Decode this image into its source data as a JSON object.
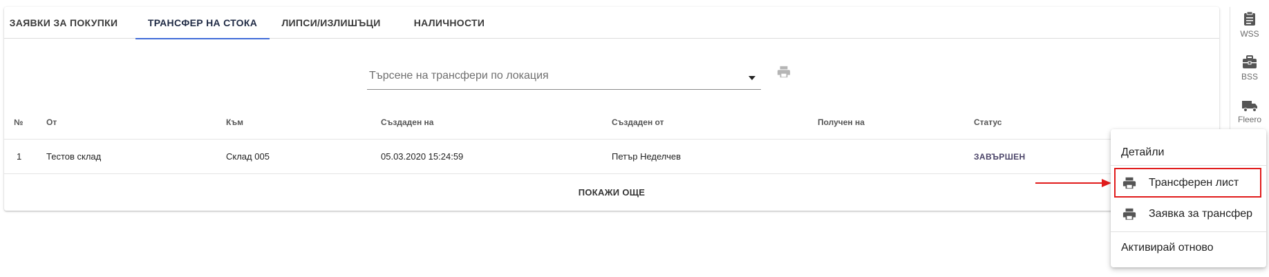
{
  "tabs": [
    {
      "label": "ЗАЯВКИ ЗА ПОКУПКИ",
      "active": false
    },
    {
      "label": "ТРАНСФЕР НА СТОКА",
      "active": true
    },
    {
      "label": "ЛИПСИ/ИЗЛИШЪЦИ",
      "active": false
    },
    {
      "label": "НАЛИЧНОСТИ",
      "active": false
    }
  ],
  "search": {
    "placeholder": "Търсене на трансфери по локация",
    "value": ""
  },
  "table": {
    "columns": [
      "№",
      "От",
      "Към",
      "Създаден на",
      "Създаден от",
      "Получен на",
      "Статус"
    ],
    "rows": [
      {
        "no": "1",
        "from": "Тестов склад",
        "to": "Склад 005",
        "created_on": "05.03.2020 15:24:59",
        "created_by": "Петър Неделчев",
        "received_on": "",
        "status": "ЗАВЪРШЕН"
      }
    ],
    "show_more": "ПОКАЖИ ОЩЕ"
  },
  "rail": [
    {
      "label": "WSS",
      "icon": "clipboard-icon"
    },
    {
      "label": "BSS",
      "icon": "briefcase-icon"
    },
    {
      "label": "Fleero",
      "icon": "truck-icon"
    }
  ],
  "context_menu": {
    "details": "Детайли",
    "transfer_sheet": "Трансферен лист",
    "transfer_request": "Заявка за трансфер",
    "reactivate": "Активирай отново"
  },
  "colors": {
    "accent": "#3f6ad8",
    "status": "#4b4468",
    "annotation": "#e11b1b"
  }
}
